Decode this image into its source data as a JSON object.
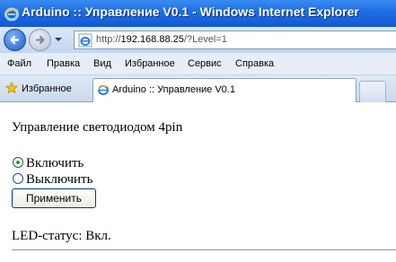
{
  "window": {
    "title": "Arduino :: Управление V0.1 - Windows Internet Explorer"
  },
  "address": {
    "url_prefix": "http://",
    "url_host": "192.168.88.25",
    "url_rest": "/?Level=1"
  },
  "menu": {
    "items": [
      "Файл",
      "Правка",
      "Вид",
      "Избранное",
      "Сервис",
      "Справка"
    ]
  },
  "favorites_label": "Избранное",
  "tab": {
    "title": "Arduino :: Управление V0.1"
  },
  "page": {
    "heading": "Управление светодиодом 4pin",
    "options": [
      {
        "label": "Включить",
        "checked": true
      },
      {
        "label": "Выключить",
        "checked": false
      }
    ],
    "apply_label": "Применить",
    "status_text": "LED-статус: Вкл."
  },
  "colors": {
    "titlebar": "#1f6fe3",
    "radio_dot": "#21a121"
  }
}
